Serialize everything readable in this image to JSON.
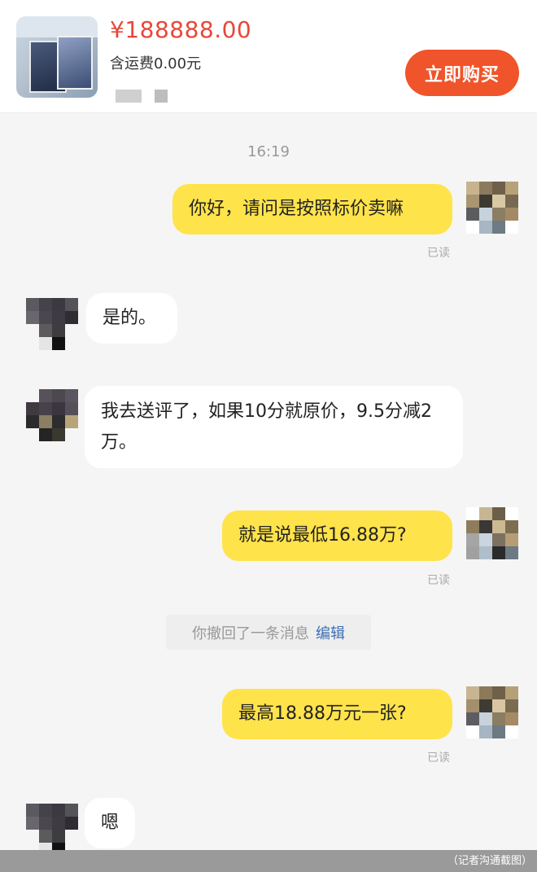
{
  "product": {
    "price": "¥188888.00",
    "shipping": "含运费0.00元",
    "buy_label": "立即购买"
  },
  "chat": {
    "time": "16:19",
    "read_label": "已读",
    "messages": [
      {
        "from": "me",
        "text": "你好，请问是按照标价卖嘛"
      },
      {
        "from": "them",
        "text": "是的。"
      },
      {
        "from": "them",
        "text": "我去送评了，如果10分就原价，9.5分减2万。"
      },
      {
        "from": "me",
        "text": "就是说最低16.88万?"
      },
      {
        "from": "me",
        "text": "最高18.88万元一张?"
      },
      {
        "from": "them",
        "text": "嗯"
      }
    ],
    "system_notice": "你撤回了一条消息",
    "system_action": "编辑"
  },
  "footer": {
    "caption": "（记者沟通截图）"
  },
  "colors": {
    "price": "#e8473a",
    "buy_button": "#f0542a",
    "my_bubble": "#ffe34a",
    "edit_link": "#3f6fb5"
  },
  "icons": {
    "product_thumbnail": "trading-card-image",
    "avatar": "pixelated-avatar"
  }
}
